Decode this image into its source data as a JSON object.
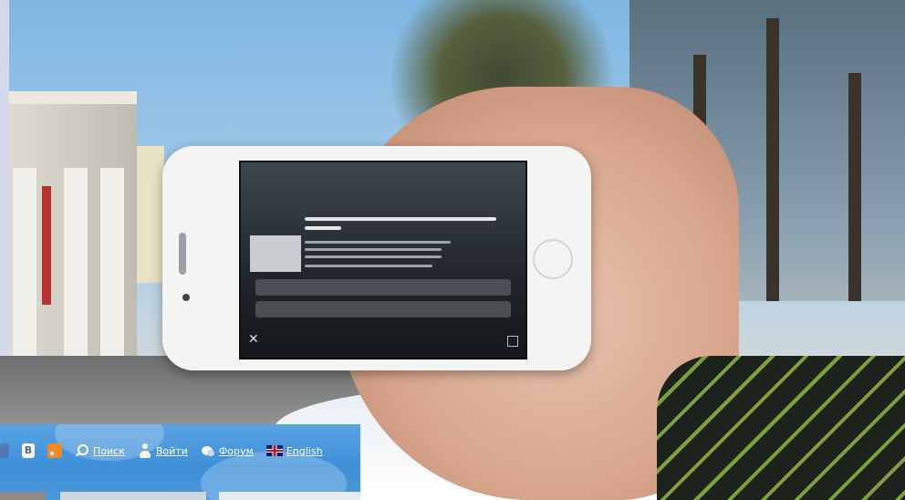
{
  "toolbar": {
    "items": [
      {
        "icon": "twitter-icon"
      },
      {
        "icon": "vk-icon",
        "glyph": "В"
      },
      {
        "icon": "rss-icon"
      },
      {
        "icon": "search-icon",
        "label": "Поиск"
      },
      {
        "icon": "user-icon",
        "label": "Войти"
      },
      {
        "icon": "forum-icon",
        "label": "Форум"
      },
      {
        "icon": "uk-flag-icon",
        "label": "English"
      }
    ]
  },
  "colors": {
    "toolbar_bg": "#4a98dc",
    "link_text": "#ffffff",
    "rss": "#f08a24"
  }
}
